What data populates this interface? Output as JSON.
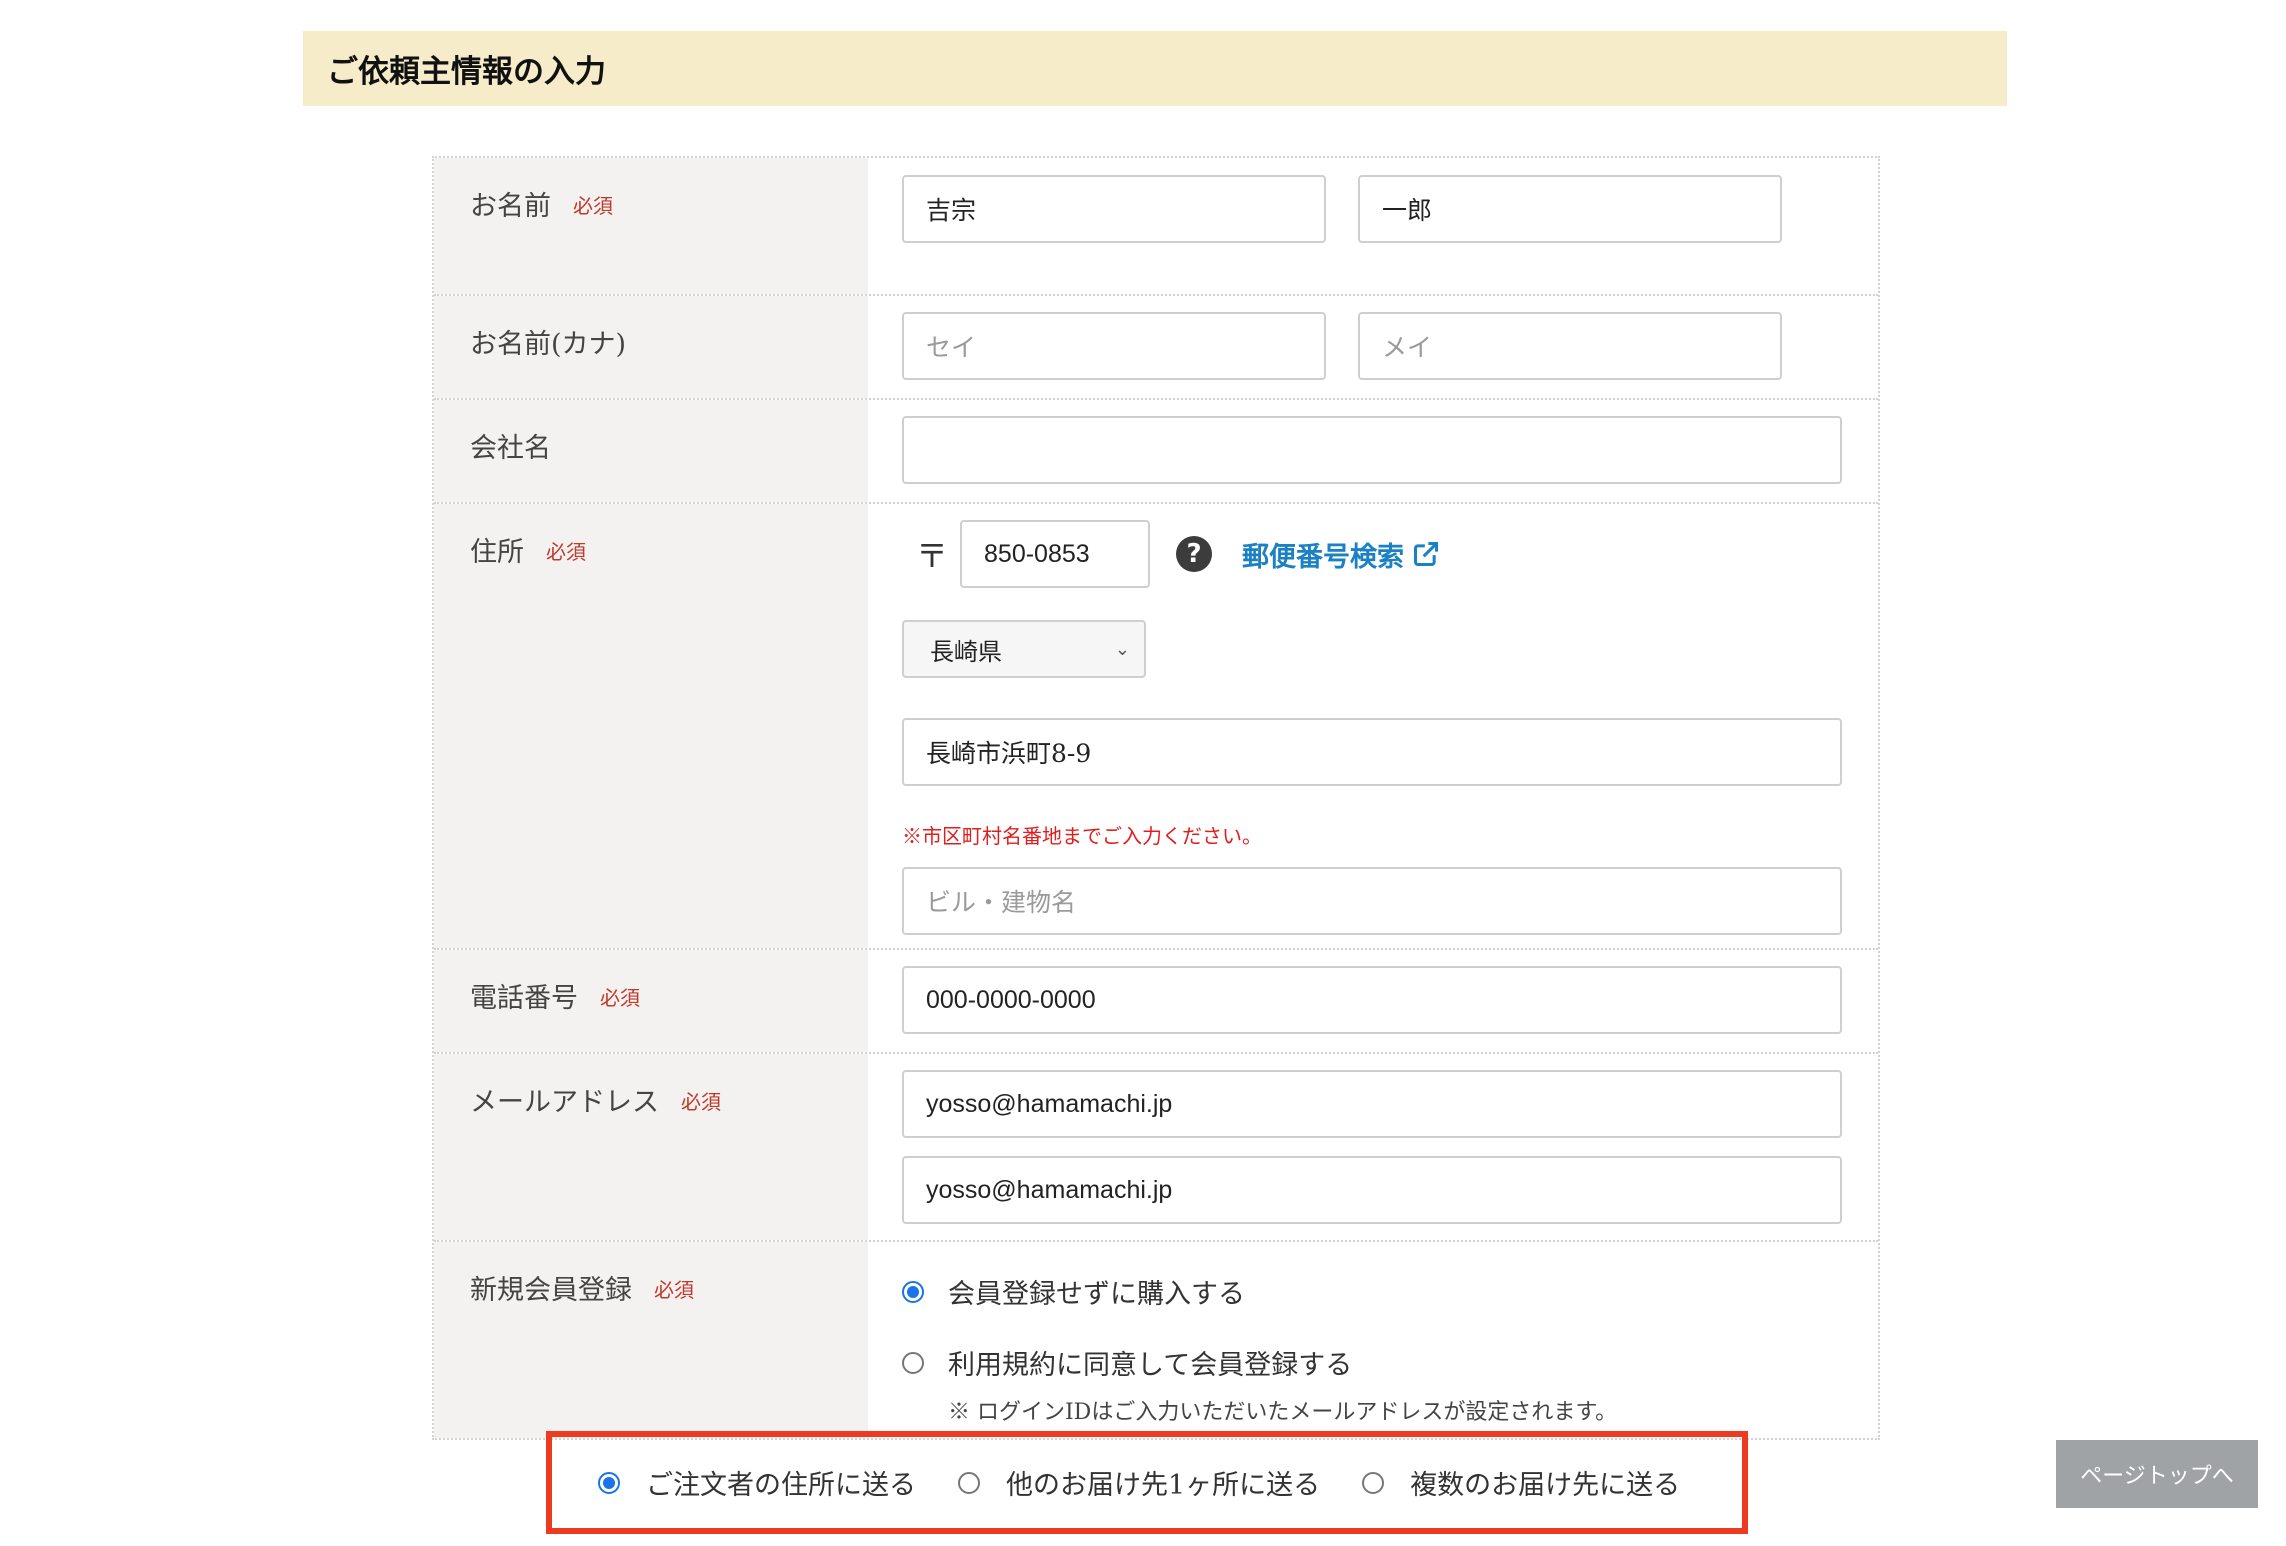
{
  "section_title": "ご依頼主情報の入力",
  "required_label": "必須",
  "form": {
    "name": {
      "label": "お名前",
      "last_value": "吉宗",
      "first_value": "一郎"
    },
    "name_kana": {
      "label": "お名前(カナ)",
      "last_placeholder": "セイ",
      "first_placeholder": "メイ"
    },
    "company": {
      "label": "会社名",
      "value": ""
    },
    "address": {
      "label": "住所",
      "zip_mark": "〒",
      "zip_value": "850-0853",
      "help_icon": "question-circle-icon",
      "zip_search_link": "郵便番号検索",
      "external_icon": "external-link-icon",
      "prefecture": "長崎県",
      "street_value": "長崎市浜町8-9",
      "note": "※市区町村名番地までご入力ください。",
      "building_placeholder": "ビル・建物名"
    },
    "phone": {
      "label": "電話番号",
      "value": "000-0000-0000"
    },
    "email": {
      "label": "メールアドレス",
      "value": "yosso@hamamachi.jp",
      "confirm_value": "yosso@hamamachi.jp"
    },
    "membership": {
      "label": "新規会員登録",
      "option_no": "会員登録せずに購入する",
      "option_yes": "利用規約に同意して会員登録する",
      "note": "※ ログインIDはご入力いただいたメールアドレスが設定されます。",
      "selected": "option_no"
    }
  },
  "shipping_options": {
    "selected": 0,
    "options": [
      "ご注文者の住所に送る",
      "他のお届け先1ヶ所に送る",
      "複数のお届け先に送る"
    ]
  },
  "page_top_button": "ページトップへ",
  "colors": {
    "header_bg": "#f7ecca",
    "label_bg": "#f3f2f0",
    "required": "#c0392b",
    "link": "#1a82c4",
    "highlight_border": "#ee3a1e",
    "radio_selected": "#1a73e8"
  }
}
